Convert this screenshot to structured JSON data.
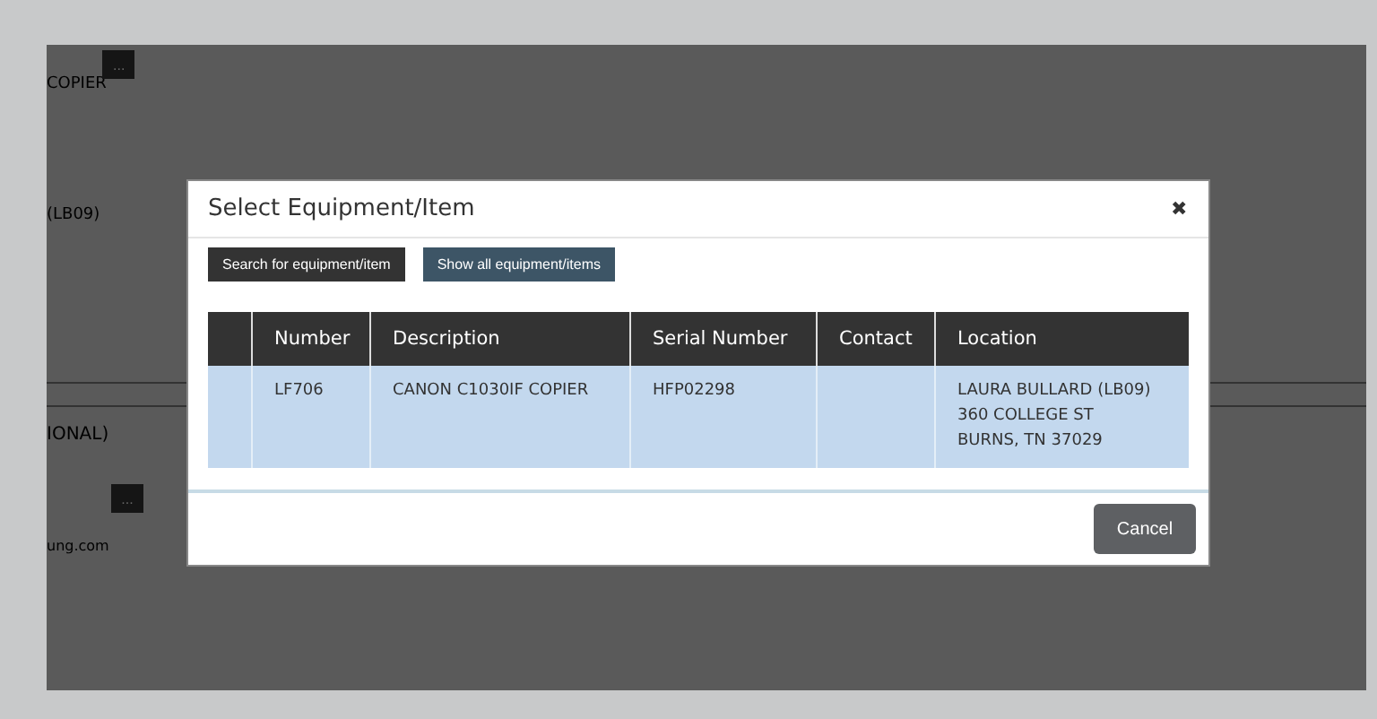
{
  "background": {
    "texts": [
      "COPIER",
      "(LB09)",
      "IONAL)",
      "ung.com"
    ],
    "more_buttons": [
      "...",
      "..."
    ]
  },
  "dialog": {
    "title": "Select Equipment/Item",
    "close": "✖",
    "buttons": [
      {
        "label": "Search for equipment/item",
        "kind": "dark"
      },
      {
        "label": "Show all equipment/items",
        "kind": "slate"
      }
    ],
    "table": {
      "columns": [
        "",
        "Number",
        "Description",
        "Serial Number",
        "Contact",
        "Location"
      ],
      "rows": [
        {
          "selected": true,
          "cells": [
            "",
            "LF706",
            "CANON C1030IF COPIER",
            "HFP02298",
            "",
            [
              "LAURA BULLARD (LB09)",
              "360 COLLEGE ST",
              "BURNS, TN 37029"
            ]
          ]
        }
      ]
    },
    "footer_buttons": [
      "Cancel"
    ]
  }
}
